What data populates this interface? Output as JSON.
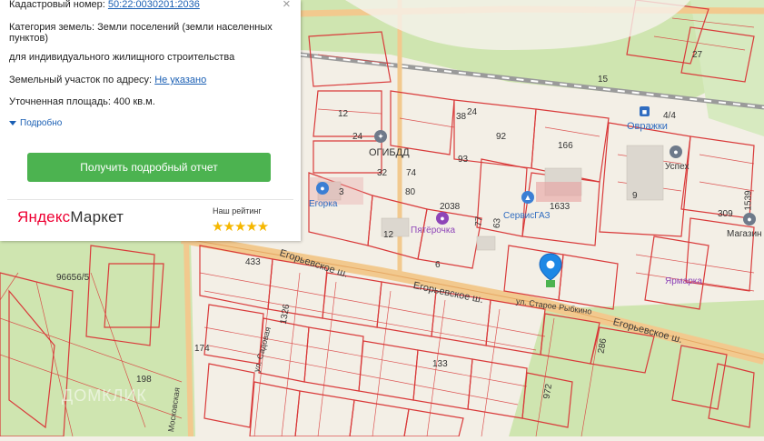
{
  "panel": {
    "cadastral_label": "Кадастровый номер:",
    "cadastral_value": "50:22:0030201:2036",
    "category_label": "Категория земель:",
    "category_value": "Земли поселений (земли населенных пунктов)",
    "category_value_line2": "для индивидуального жилищного строительства",
    "address_label": "Земельный участок по адресу:",
    "address_value": "Не указано",
    "area_label": "Уточненная площадь:",
    "area_value": "400 кв.м.",
    "more_link": "Подробно",
    "report_button": "Получить подробный отчет",
    "market_logo_y": "Яндекс",
    "market_logo_m": "Маркет",
    "rating_label": "Наш рейтинг",
    "rating_stars": "★★★★★",
    "rating_value": 5,
    "close_glyph": "×"
  },
  "map": {
    "labels": {
      "n27": "27",
      "n15": "15",
      "n24": "24",
      "n74": "74",
      "n32": "32",
      "n80": "80",
      "n3": "3",
      "n12": "12",
      "n6": "6",
      "n92": "92",
      "n93": "93",
      "n166": "166",
      "n9": "9",
      "n1633": "1633",
      "n2038": "2038",
      "n433": "433",
      "n1326": "1326",
      "n174": "174",
      "n198": "198",
      "n96656": "96656/5",
      "n133": "133",
      "n286": "286",
      "n1539": "1539",
      "n309": "309",
      "n77": "77",
      "n63": "63",
      "n4_4": "4/4",
      "n12b": "12",
      "n38": "38",
      "n24b": "24",
      "n972": "972"
    },
    "roads": {
      "egorevskoe1": "Егорьевское ш.",
      "egorevskoe2": "Егорьевское ш.",
      "egorevskoe3": "Егорьевское ш.",
      "staroe": "ул. Старое Рыбкино",
      "sadovaya": "ул. Садовая",
      "moskovskaya": "Московская"
    },
    "pois": {
      "gibdd": "ОГИБДД",
      "egorka": "Егорка",
      "pyaterochka": "Пятёрочка",
      "servis": "СервисГАЗ",
      "ovrazhki": "Овражки",
      "uspeh": "Успех",
      "magazin": "Магазин",
      "market_right": "Ярмарка"
    },
    "watermark": "ДОМКЛИК",
    "colors": {
      "parcel": "#d93a3a",
      "road": "#f2c98e",
      "green": "#cfe5b0",
      "water": "#a9d3e5"
    }
  }
}
